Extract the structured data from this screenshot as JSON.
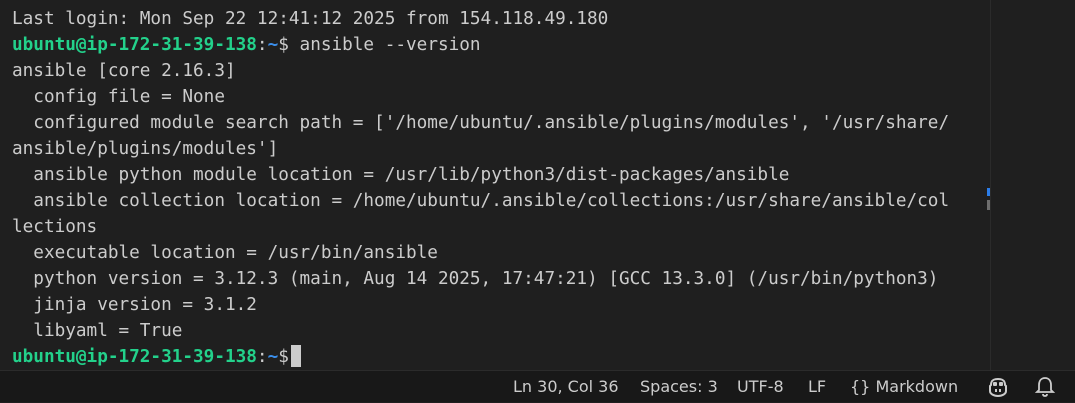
{
  "terminal": {
    "last_login": "Last login: Mon Sep 22 12:41:12 2025 from 154.118.49.180",
    "prompt_user": "ubuntu@ip-172-31-39-138",
    "prompt_colon": ":",
    "prompt_path": "~",
    "prompt_dollar": "$",
    "command": " ansible --version",
    "output": [
      "ansible [core 2.16.3]",
      "  config file = None",
      "  configured module search path = ['/home/ubuntu/.ansible/plugins/modules', '/usr/share/",
      "ansible/plugins/modules']",
      "  ansible python module location = /usr/lib/python3/dist-packages/ansible",
      "  ansible collection location = /home/ubuntu/.ansible/collections:/usr/share/ansible/col",
      "lections",
      "  executable location = /usr/bin/ansible",
      "  python version = 3.12.3 (main, Aug 14 2025, 17:47:21) [GCC 13.3.0] (/usr/bin/python3)",
      "  jinja version = 3.1.2",
      "  libyaml = True"
    ]
  },
  "statusbar": {
    "cursor_position": "Ln 30, Col 36",
    "spaces": "Spaces: 3",
    "encoding": "UTF-8",
    "eol": "LF",
    "language_braces": "{}",
    "language": "Markdown",
    "icons": {
      "copilot": "copilot-icon",
      "notifications": "bell-icon"
    }
  },
  "colors": {
    "background": "#1f1f1f",
    "prompt_user": "#23d18b",
    "prompt_path": "#3b8eea",
    "text": "#cccccc",
    "statusbar_bg": "#181818"
  }
}
